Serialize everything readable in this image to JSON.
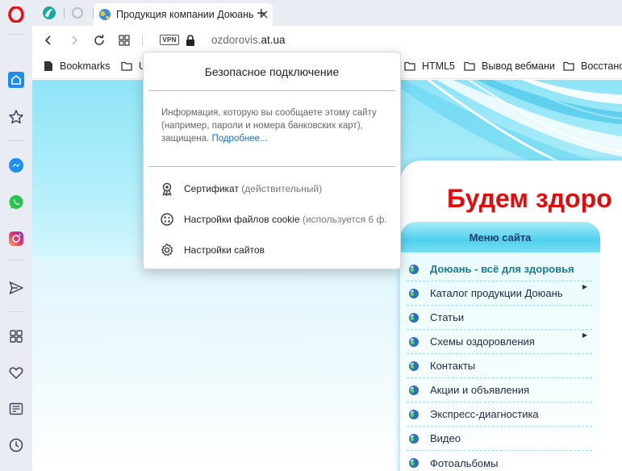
{
  "browser": {
    "tabs": [
      {
        "title": ""
      },
      {
        "title": ""
      },
      {
        "title": "Продукция компании Доюань"
      }
    ],
    "new_tab_label": "+",
    "vpn_label": "VPN",
    "url_prefix": "ozdorovis.",
    "url_domain": "at.ua"
  },
  "bookmarks": [
    {
      "label": "Bookmarks"
    },
    {
      "label": "U"
    },
    {
      "label": "HTML5"
    },
    {
      "label": "Вывод вебмани"
    },
    {
      "label": "Восстано"
    }
  ],
  "popup": {
    "title": "Безопасное подключение",
    "info_text": "Информация, которую вы сообщаете этому сайту (например, пароли и номера банковских карт), защищена.",
    "info_link": "Подробнее...",
    "certificate_label": "Сертификат",
    "certificate_status": "(действительный)",
    "cookies_label": "Настройки файлов cookie",
    "cookies_status": "(используется 6 ф.",
    "site_settings_label": "Настройки сайтов"
  },
  "site": {
    "headline": "Будем здоро",
    "menu_title": "Меню сайта",
    "menu_items": [
      {
        "label": "Доюань - всё для здоровья",
        "active": true
      },
      {
        "label": "Каталог продукции Доюань",
        "submenu": true
      },
      {
        "label": "Статьи"
      },
      {
        "label": "Схемы оздоровления",
        "submenu": true
      },
      {
        "label": "Контакты"
      },
      {
        "label": "Акции и объявления"
      },
      {
        "label": "Экспресс-диагностика"
      },
      {
        "label": "Видео"
      },
      {
        "label": "Фотоальбомы"
      }
    ]
  },
  "colors": {
    "opera_red": "#e8101a",
    "headline_red": "#e30b0b",
    "link_blue": "#1a6fc9",
    "menu_text_active": "#1b7b95"
  }
}
